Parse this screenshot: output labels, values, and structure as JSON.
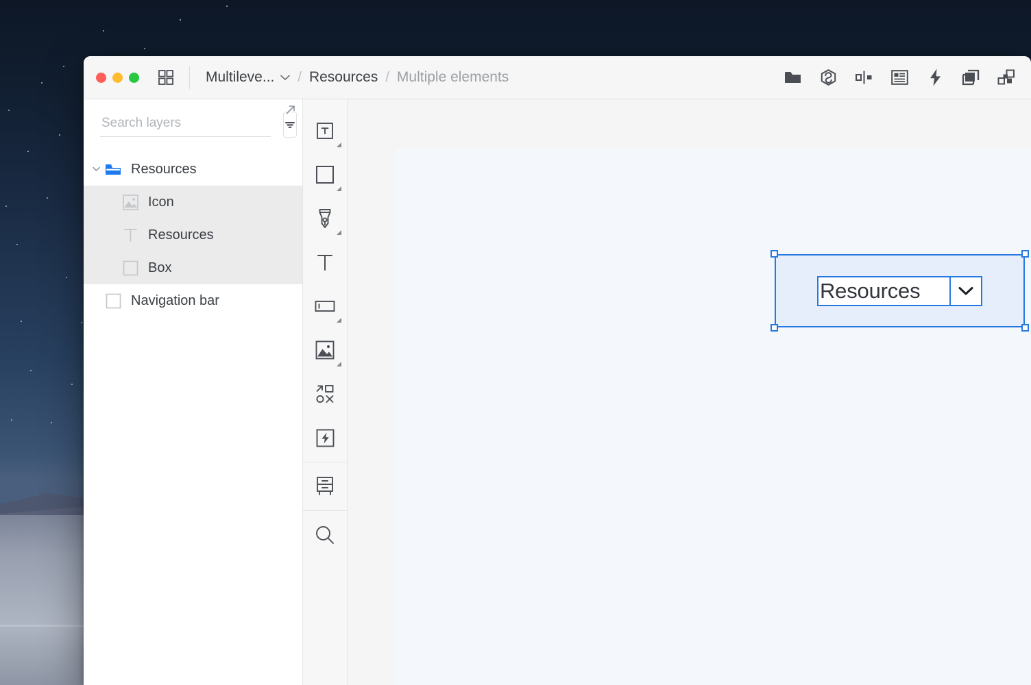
{
  "window": {
    "traffic_lights": [
      {
        "name": "close",
        "color": "#ff5f57"
      },
      {
        "name": "minimize",
        "color": "#febc2e"
      },
      {
        "name": "zoom",
        "color": "#28c840"
      }
    ],
    "grid_icon": "grid-icon"
  },
  "breadcrumb": {
    "document": "Multileve...",
    "separator": "/",
    "parent": "Resources",
    "current": "Multiple elements"
  },
  "toolbar": {
    "items": [
      {
        "name": "folder-icon",
        "label": "Folder"
      },
      {
        "name": "symbol-icon",
        "label": "Symbol"
      },
      {
        "name": "distribute-icon",
        "label": "Distribute"
      },
      {
        "name": "content-icon",
        "label": "Content"
      },
      {
        "name": "lightning-icon",
        "label": "Prototype"
      },
      {
        "name": "duplicate-icon",
        "label": "Duplicate"
      },
      {
        "name": "components-icon",
        "label": "Components"
      }
    ]
  },
  "sidebar": {
    "search": {
      "placeholder": "Search layers",
      "value": ""
    },
    "filter_icon": "filter-icon",
    "expand_icon": "expand-arrow-icon",
    "layers": [
      {
        "label": "Resources",
        "icon": "folder-icon",
        "depth": 0,
        "expanded": true,
        "selected": false,
        "has_disclosure": true
      },
      {
        "label": "Icon",
        "icon": "image-icon",
        "depth": 1,
        "selected": true,
        "has_disclosure": false
      },
      {
        "label": "Resources",
        "icon": "text-icon",
        "depth": 1,
        "selected": true,
        "has_disclosure": false
      },
      {
        "label": "Box",
        "icon": "rect-icon",
        "depth": 1,
        "selected": true,
        "has_disclosure": false
      },
      {
        "label": "Navigation bar",
        "icon": "rect-icon",
        "depth": 0,
        "selected": false,
        "has_disclosure": false
      }
    ]
  },
  "rail": {
    "tools": [
      {
        "name": "artboard-tool",
        "icon": "artboard-icon",
        "has_submenu": true
      },
      {
        "name": "rectangle-tool",
        "icon": "rect-icon",
        "has_submenu": true
      },
      {
        "name": "pen-tool",
        "icon": "pen-icon",
        "has_submenu": true
      },
      {
        "name": "text-tool",
        "icon": "text-icon",
        "has_submenu": false
      },
      {
        "name": "input-tool",
        "icon": "input-field-icon",
        "has_submenu": true
      },
      {
        "name": "image-tool",
        "icon": "image-icon",
        "has_submenu": true
      },
      {
        "name": "transform-tool",
        "icon": "transform-icon",
        "has_submenu": false
      },
      {
        "name": "prototype-tool",
        "icon": "lightning-box-icon",
        "has_submenu": false
      },
      {
        "name": "library-tool",
        "icon": "drawer-icon",
        "has_submenu": false,
        "separator_before": true
      },
      {
        "name": "zoom-tool",
        "icon": "search-icon",
        "has_submenu": false,
        "separator_before": true
      }
    ]
  },
  "canvas": {
    "selection": {
      "handles": [
        "top-left",
        "top-right",
        "bottom-left",
        "bottom-right"
      ],
      "accent_color": "#2679e0"
    },
    "element": {
      "type": "dropdown",
      "value": "Resources",
      "chevron_icon": "chevron-down-icon"
    }
  },
  "colors": {
    "accent": "#2679e0",
    "selected_row": "#ebebeb",
    "titlebar": "#f6f6f6",
    "canvas": "#f5f5f5",
    "artboard": "#f4f8fc",
    "folder_blue": "#1d7aef"
  }
}
